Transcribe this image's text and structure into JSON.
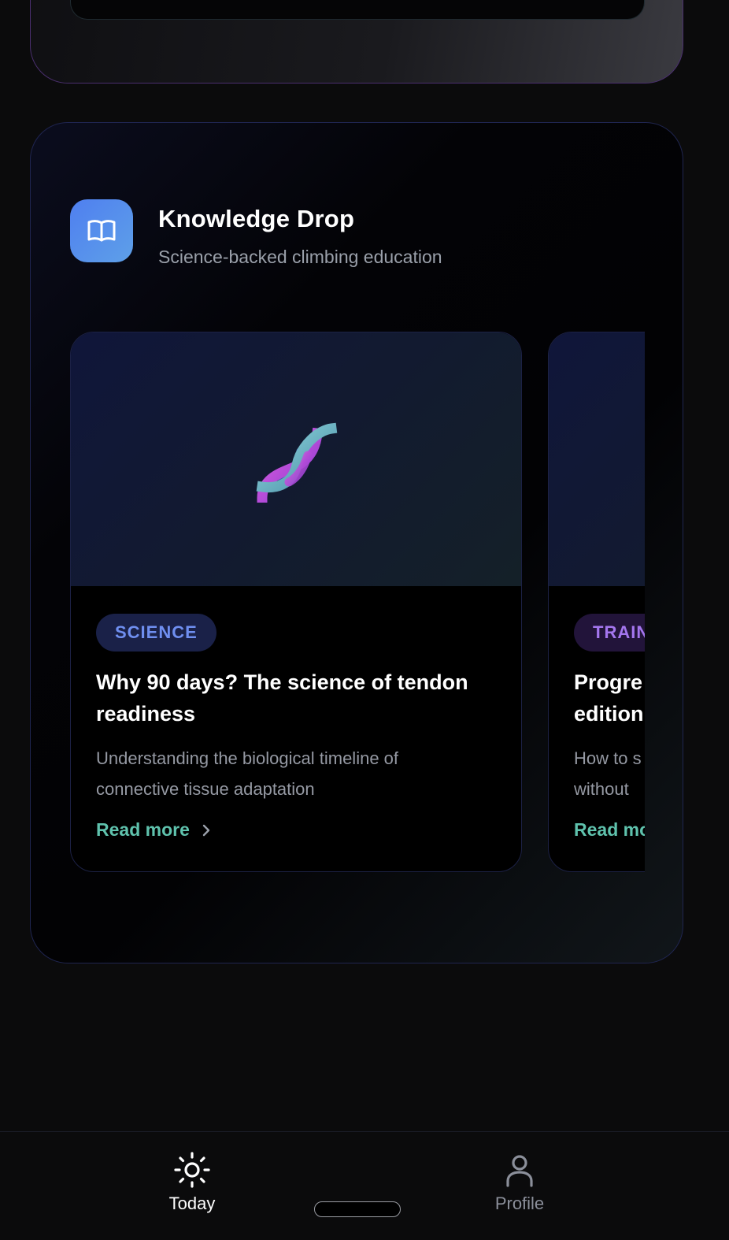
{
  "knowledge": {
    "title": "Knowledge Drop",
    "subtitle": "Science-backed climbing education",
    "icon": "book-open-icon",
    "articles": [
      {
        "tag": "SCIENCE",
        "tag_color": "#6f8ff0",
        "icon": "dna-icon",
        "title_line1": "Why 90 days? The science of tendon",
        "title_line2": "readiness",
        "desc_line1": "Understanding the biological timeline of",
        "desc_line2": "connective tissue adaptation",
        "cta": "Read more"
      },
      {
        "tag": "TRAIN",
        "tag_color": "#a476ee",
        "title_line1": "Progre",
        "title_line2": "edition",
        "desc_line1": "How to s",
        "desc_line2": "without",
        "cta": "Read mo"
      }
    ]
  },
  "nav": {
    "today": {
      "label": "Today",
      "icon": "sun-icon"
    },
    "profile": {
      "label": "Profile",
      "icon": "user-icon"
    }
  },
  "colors": {
    "accent_teal": "#5fc2ad",
    "accent_blue": "#4f7ff0",
    "background": "#0b0b0c"
  }
}
